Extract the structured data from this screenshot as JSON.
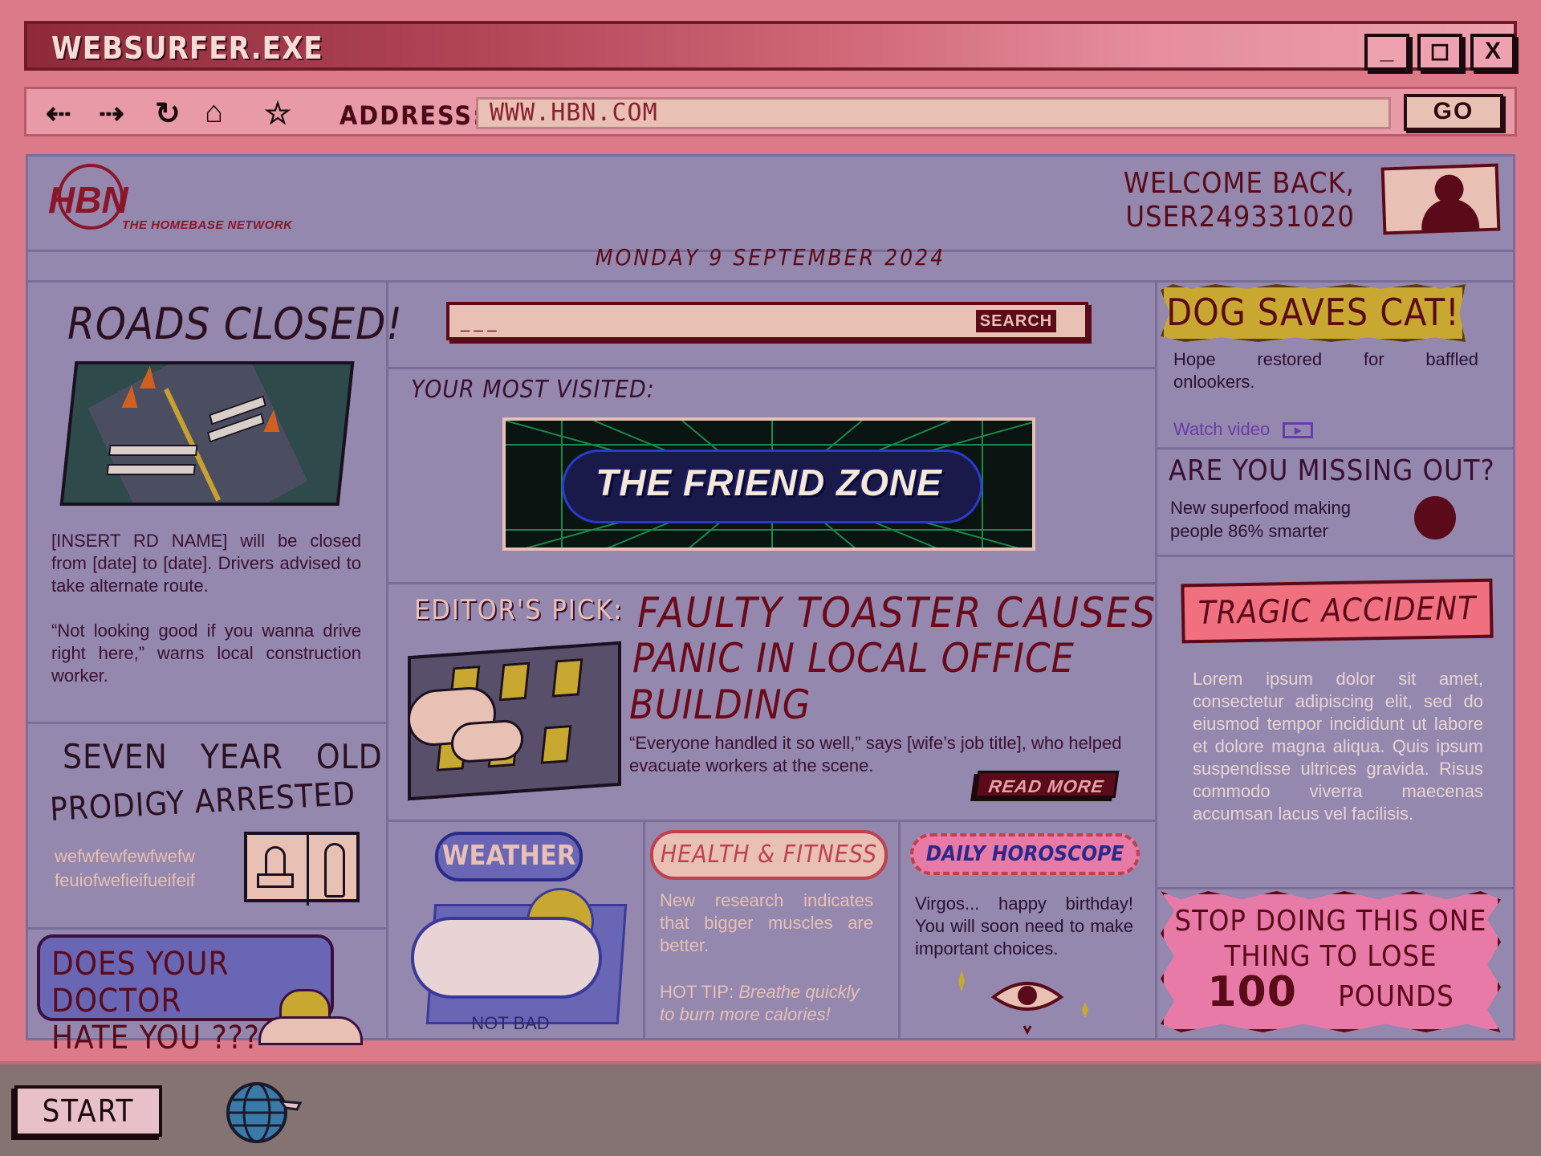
{
  "window": {
    "title": "WEBSURFER.EXE",
    "controls": {
      "minimize": "_",
      "maximize": "◻",
      "close": "X"
    }
  },
  "navbar": {
    "address_label": "ADDRESS:",
    "address_value": "WWW.HBN.COM",
    "go_label": "GO"
  },
  "header": {
    "logo": "HBN",
    "tagline": "THE HOMEBASE NETWORK",
    "welcome_line1": "WELCOME BACK,",
    "welcome_line2": "USER249331020",
    "date": "MONDAY 9 SEPTEMBER 2024"
  },
  "left": {
    "roads": {
      "title": "ROADS CLOSED!",
      "para1": "[INSERT RD NAME] will be closed from [date] to [date]. Drivers advised to take alternate route.",
      "para2": "“Not looking good if you wanna drive right here,” warns local construction worker."
    },
    "prodigy": {
      "title_line1": "SEVEN YEAR OLD",
      "title_line2": "PRODIGY ARRESTED",
      "text_line1": "wefwfewfewfwefw",
      "text_line2": "feuiofwefieifueifeif"
    },
    "doctor": {
      "line1": "DOES YOUR DOCTOR",
      "line2": "HATE YOU ???"
    }
  },
  "center": {
    "search": {
      "placeholder": "_ _ _",
      "button": "SEARCH"
    },
    "most_visited_label": "YOUR MOST VISITED:",
    "banner_title": "THE FRIEND ZONE",
    "editors_pick": {
      "label": "EDITOR'S PICK:",
      "headline_line1": "FAULTY TOASTER CAUSES",
      "headline_line2": "PANIC IN LOCAL OFFICE",
      "headline_line3": "BUILDING",
      "body": "“Everyone handled it so well,” says [wife’s job title], who helped evacuate workers at the scene.",
      "read_more": "READ MORE"
    },
    "weather": {
      "label": "WEATHER",
      "status": "NOT BAD"
    },
    "health": {
      "label": "HEALTH & FITNESS",
      "body": "New research indicates that bigger muscles are better.",
      "tip_label": "HOT TIP:",
      "tip_text": "Breathe quickly to burn more calories!"
    },
    "horoscope": {
      "label": "DAILY HOROSCOPE",
      "body": "Virgos... happy birthday! You will soon need to make important choices."
    }
  },
  "right": {
    "dog": {
      "title": "DOG SAVES CAT!",
      "body": "Hope restored for baffled onlookers.",
      "watch": "Watch video"
    },
    "missing": {
      "title": "ARE YOU MISSING OUT?",
      "body_line1": "New superfood making",
      "body_line2": "people 86% smarter"
    },
    "tragic": {
      "title": "TRAGIC ACCIDENT",
      "body": "Lorem ipsum dolor sit amet, consectetur adipiscing elit, sed do eiusmod tempor incididunt ut labore et dolore magna aliqua. Quis ipsum suspendisse ultrices gravida. Risus commodo viverra maecenas accumsan lacus vel facilisis."
    },
    "stop": {
      "line1": "STOP DOING THIS ONE",
      "line2": "THING TO LOSE",
      "number": "100",
      "unit": "POUNDS"
    }
  },
  "taskbar": {
    "start": "START"
  },
  "icons": {
    "back": "back-arrow-icon",
    "forward": "forward-arrow-icon",
    "refresh": "refresh-icon",
    "home": "home-icon",
    "favorite": "star-icon",
    "video": "play-icon",
    "apple": "apple-icon",
    "eye": "eye-icon",
    "globe": "globe-icon"
  },
  "colors": {
    "window_bg": "#dc7a8a",
    "page_bg": "#9488ae",
    "accent_dark": "#5a0a18",
    "gold": "#c8a830",
    "pink": "#e87aa8",
    "purple_link": "#6a3aa8"
  }
}
